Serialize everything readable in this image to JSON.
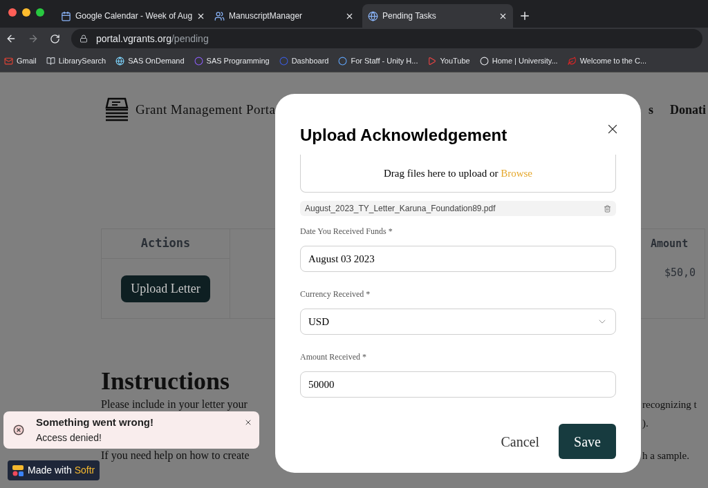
{
  "browser": {
    "tabs": [
      {
        "title": "Google Calendar - Week of Aug",
        "selected": false
      },
      {
        "title": "ManuscriptManager",
        "selected": false
      },
      {
        "title": "Pending Tasks",
        "selected": true
      }
    ],
    "url": {
      "host": "portal.vgrants.org",
      "path": "/pending"
    },
    "bookmarks": [
      "Gmail",
      "LibrarySearch",
      "SAS OnDemand",
      "SAS Programming",
      "Dashboard",
      "For Staff - Unity H...",
      "YouTube",
      "Home | University...",
      "Welcome to the C..."
    ]
  },
  "page": {
    "site_title": "Grant Management Porta",
    "nav": [
      "s",
      "Donati"
    ],
    "table": {
      "columns": [
        "Actions",
        "Amount"
      ],
      "rows": [
        {
          "action": "Upload Letter",
          "amount": "$50,0"
        }
      ]
    },
    "instructions": {
      "heading": "Instructions",
      "lines": [
        {
          "left": "Please include in your letter your",
          "right": "recognizing t"
        },
        {
          "right": ")."
        },
        {
          "left": "If you need help on how to create",
          "right": "h a sample."
        }
      ]
    }
  },
  "modal": {
    "title": "Upload Acknowledgement",
    "dropzone": {
      "text": "Drag files here to upload or",
      "link": "Browse"
    },
    "file": "August_2023_TY_Letter_Karuna_Foundation89.pdf",
    "fields": [
      {
        "label": "Date You Received Funds *",
        "value": "August 03 2023",
        "kind": "text"
      },
      {
        "label": "Currency Received *",
        "value": "USD",
        "kind": "select"
      },
      {
        "label": "Amount Received *",
        "value": "50000",
        "kind": "text"
      }
    ],
    "buttons": {
      "cancel": "Cancel",
      "save": "Save"
    }
  },
  "toast": {
    "title": "Something went wrong!",
    "message": "Access denied!"
  },
  "badge": {
    "text": "Made with",
    "brand": "Softr"
  }
}
